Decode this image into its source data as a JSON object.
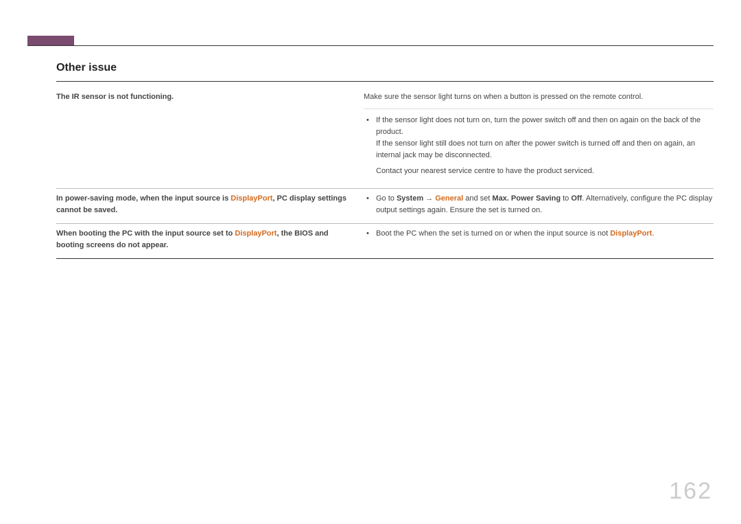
{
  "section_title": "Other issue",
  "page_number": "162",
  "rows": {
    "r1": {
      "issue": "The IR sensor is not functioning.",
      "intro": "Make sure the sensor light turns on when a button is pressed on the remote control.",
      "bullet1": "If the sensor light does not turn on, turn the power switch off and then on again on the back of the product.",
      "note1": "If the sensor light still does not turn on after the power switch is turned off and then on again, an internal jack may be disconnected.",
      "note2": "Contact your nearest service centre to have the product serviced."
    },
    "r2": {
      "issue_pre": "In power-saving mode, when the input source is ",
      "issue_hl": "DisplayPort",
      "issue_post": ", PC display settings cannot be saved.",
      "sol_pre": "Go to ",
      "sol_system": "System",
      "sol_arrow": " → ",
      "sol_general": "General",
      "sol_mid": " and set ",
      "sol_max": "Max. Power Saving",
      "sol_to": " to ",
      "sol_off": "Off",
      "sol_post": ". Alternatively, configure the PC display output settings again. Ensure the set is turned on."
    },
    "r3": {
      "issue_pre": "When booting the PC with the input source set to ",
      "issue_hl": "DisplayPort",
      "issue_post": ", the BIOS and booting screens do not appear.",
      "sol_pre": "Boot the PC when the set is turned on or when the input source is not ",
      "sol_hl": "DisplayPort",
      "sol_post": "."
    }
  }
}
